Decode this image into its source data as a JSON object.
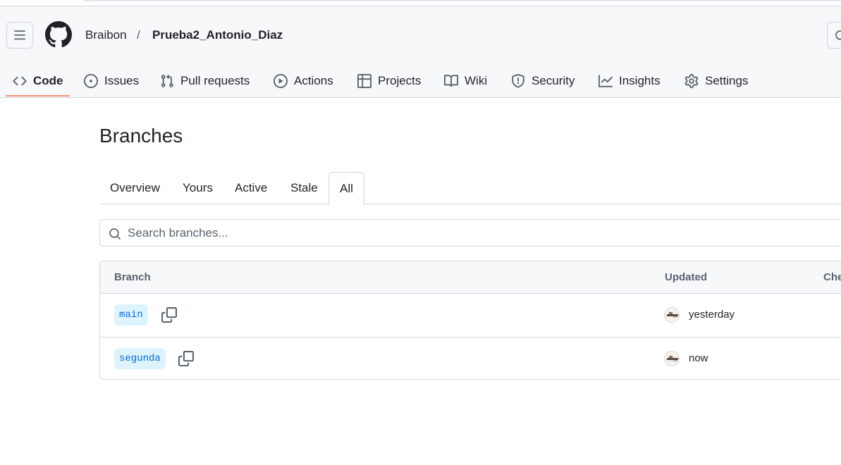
{
  "breadcrumb": {
    "owner": "Braibon",
    "separator": "/",
    "repo": "Prueba2_Antonio_Diaz"
  },
  "repo_tabs": [
    {
      "label": "Code",
      "icon": "code-icon",
      "selected": true
    },
    {
      "label": "Issues",
      "icon": "issue-opened-icon"
    },
    {
      "label": "Pull requests",
      "icon": "git-pull-request-icon"
    },
    {
      "label": "Actions",
      "icon": "play-icon"
    },
    {
      "label": "Projects",
      "icon": "table-icon"
    },
    {
      "label": "Wiki",
      "icon": "book-icon"
    },
    {
      "label": "Security",
      "icon": "shield-icon"
    },
    {
      "label": "Insights",
      "icon": "graph-icon"
    },
    {
      "label": "Settings",
      "icon": "gear-icon"
    }
  ],
  "page_title": "Branches",
  "branch_tabs": [
    {
      "label": "Overview"
    },
    {
      "label": "Yours"
    },
    {
      "label": "Active"
    },
    {
      "label": "Stale"
    },
    {
      "label": "All",
      "active": true
    }
  ],
  "search": {
    "placeholder": "Search branches..."
  },
  "table": {
    "headers": {
      "branch": "Branch",
      "updated": "Updated",
      "checks": "Che"
    },
    "rows": [
      {
        "branch": "main",
        "updated": "yesterday"
      },
      {
        "branch": "segunda",
        "updated": "now"
      }
    ]
  },
  "colors": {
    "selected_tab_underline": "#fd8c73",
    "branch_pill_bg": "#ddf4ff",
    "branch_pill_text": "#0969da",
    "border": "#d0d7de"
  }
}
